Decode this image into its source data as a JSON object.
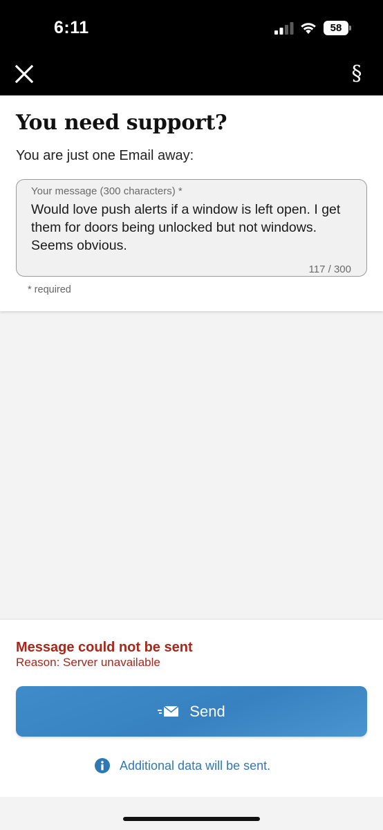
{
  "status_bar": {
    "time": "6:11",
    "battery_level": "58",
    "icons": [
      "signal-icon",
      "wifi-icon",
      "battery-icon"
    ]
  },
  "nav": {
    "close_icon": "close-icon",
    "legal_symbol": "§"
  },
  "form": {
    "title": "You need support?",
    "subtitle": "You are just one Email away:",
    "message_label": "Your message (300 characters) *",
    "message_value": "Would love push alerts if a window is left open. I get them for doors being unlocked but not windows. Seems obvious.",
    "char_count": "117 / 300",
    "required_note": "* required"
  },
  "error": {
    "title": "Message could not be sent",
    "reason": "Reason: Server unavailable"
  },
  "actions": {
    "send_label": "Send",
    "send_icon": "send-mail-icon",
    "info_text": "Additional data will be sent.",
    "info_icon": "info-icon"
  },
  "colors": {
    "top_bar": "#000000",
    "error": "#a5281c",
    "accent": "#3781c0",
    "link": "#2f78b4",
    "background": "#f3f3f3"
  }
}
